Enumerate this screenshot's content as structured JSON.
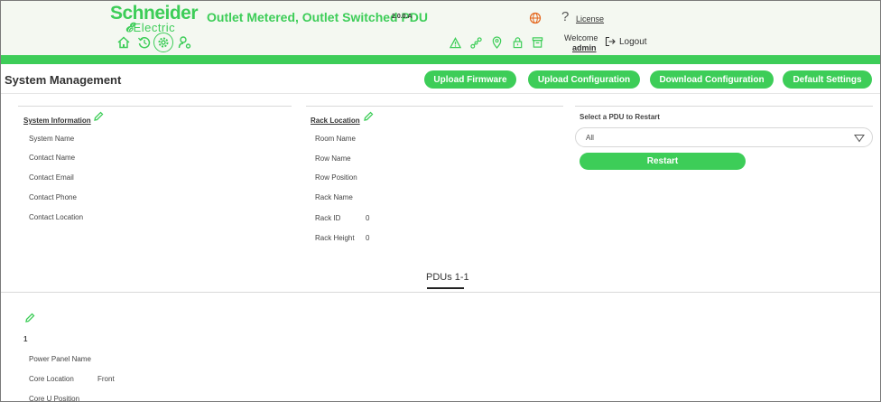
{
  "header": {
    "brand_top": "Schneider",
    "brand_bottom": "Electric",
    "app_title": "Outlet Metered, Outlet Switched PDU",
    "version": "2.0.0.A",
    "license_label": "License",
    "welcome_label": "Welcome",
    "user_name": "admin",
    "logout_label": "Logout"
  },
  "nav_icons": [
    "home-icon",
    "history-icon",
    "settings-icon",
    "user-settings-icon"
  ],
  "status_icons": [
    "alarm-icon",
    "network-icon",
    "location-icon",
    "lock-icon",
    "archive-icon"
  ],
  "colors": {
    "brand_green": "#3dcd58",
    "header_bg": "#f4f8f1"
  },
  "page": {
    "title": "System Management",
    "buttons": {
      "upload_firmware": "Upload Firmware",
      "upload_configuration": "Upload Configuration",
      "download_configuration": "Download Configuration",
      "default_settings": "Default Settings"
    }
  },
  "system_information": {
    "heading": "System Information",
    "labels": [
      "System Name",
      "Contact Name",
      "Contact Email",
      "Contact Phone",
      "Contact Location"
    ]
  },
  "rack_location": {
    "heading": "Rack Location",
    "room_name": "Room Name",
    "row_name": "Row Name",
    "row_position": "Row Position",
    "rack_name": "Rack Name",
    "rack_id_label": "Rack ID",
    "rack_id_value": "0",
    "rack_height_label": "Rack Height",
    "rack_height_value": "0"
  },
  "restart": {
    "label": "Select a PDU to Restart",
    "selected": "All",
    "button": "Restart"
  },
  "pdus": {
    "tab_label": "PDUs 1-1",
    "index": "1",
    "power_panel_label": "Power Panel Name",
    "core_location_label": "Core Location",
    "core_location_value": "Front",
    "core_u_position_label": "Core U Position"
  }
}
